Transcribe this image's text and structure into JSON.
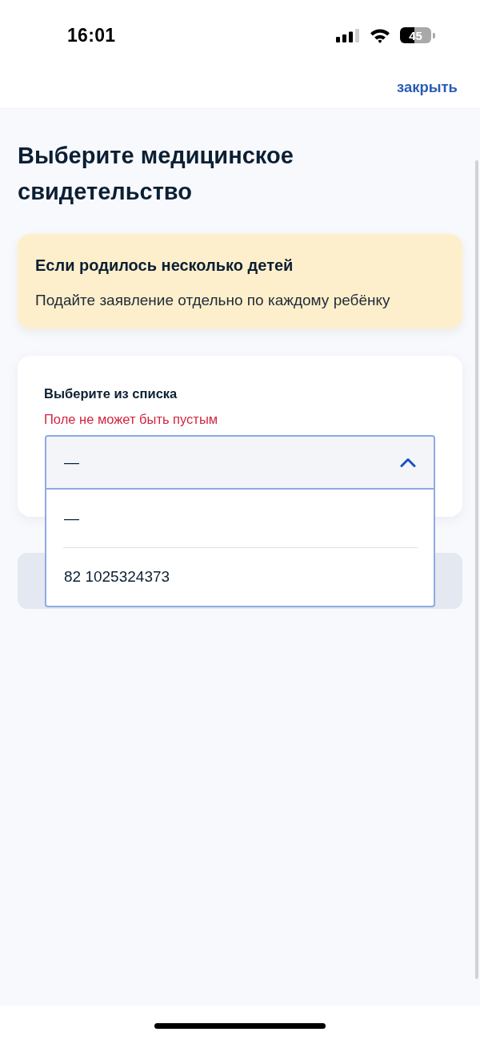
{
  "status_bar": {
    "time": "16:01",
    "battery": "45"
  },
  "header": {
    "close_link": "закрыть"
  },
  "title": "Выберите медицинское свидетельство",
  "notice": {
    "title": "Если родилось несколько детей",
    "text": "Подайте заявление отдельно по каждому ребёнку"
  },
  "form": {
    "label": "Выберите из списка",
    "error": "Поле не может быть пустым",
    "select": {
      "value": "—",
      "expanded": true,
      "options": [
        {
          "label": "—"
        },
        {
          "label": "82 1025324373"
        }
      ]
    }
  }
}
